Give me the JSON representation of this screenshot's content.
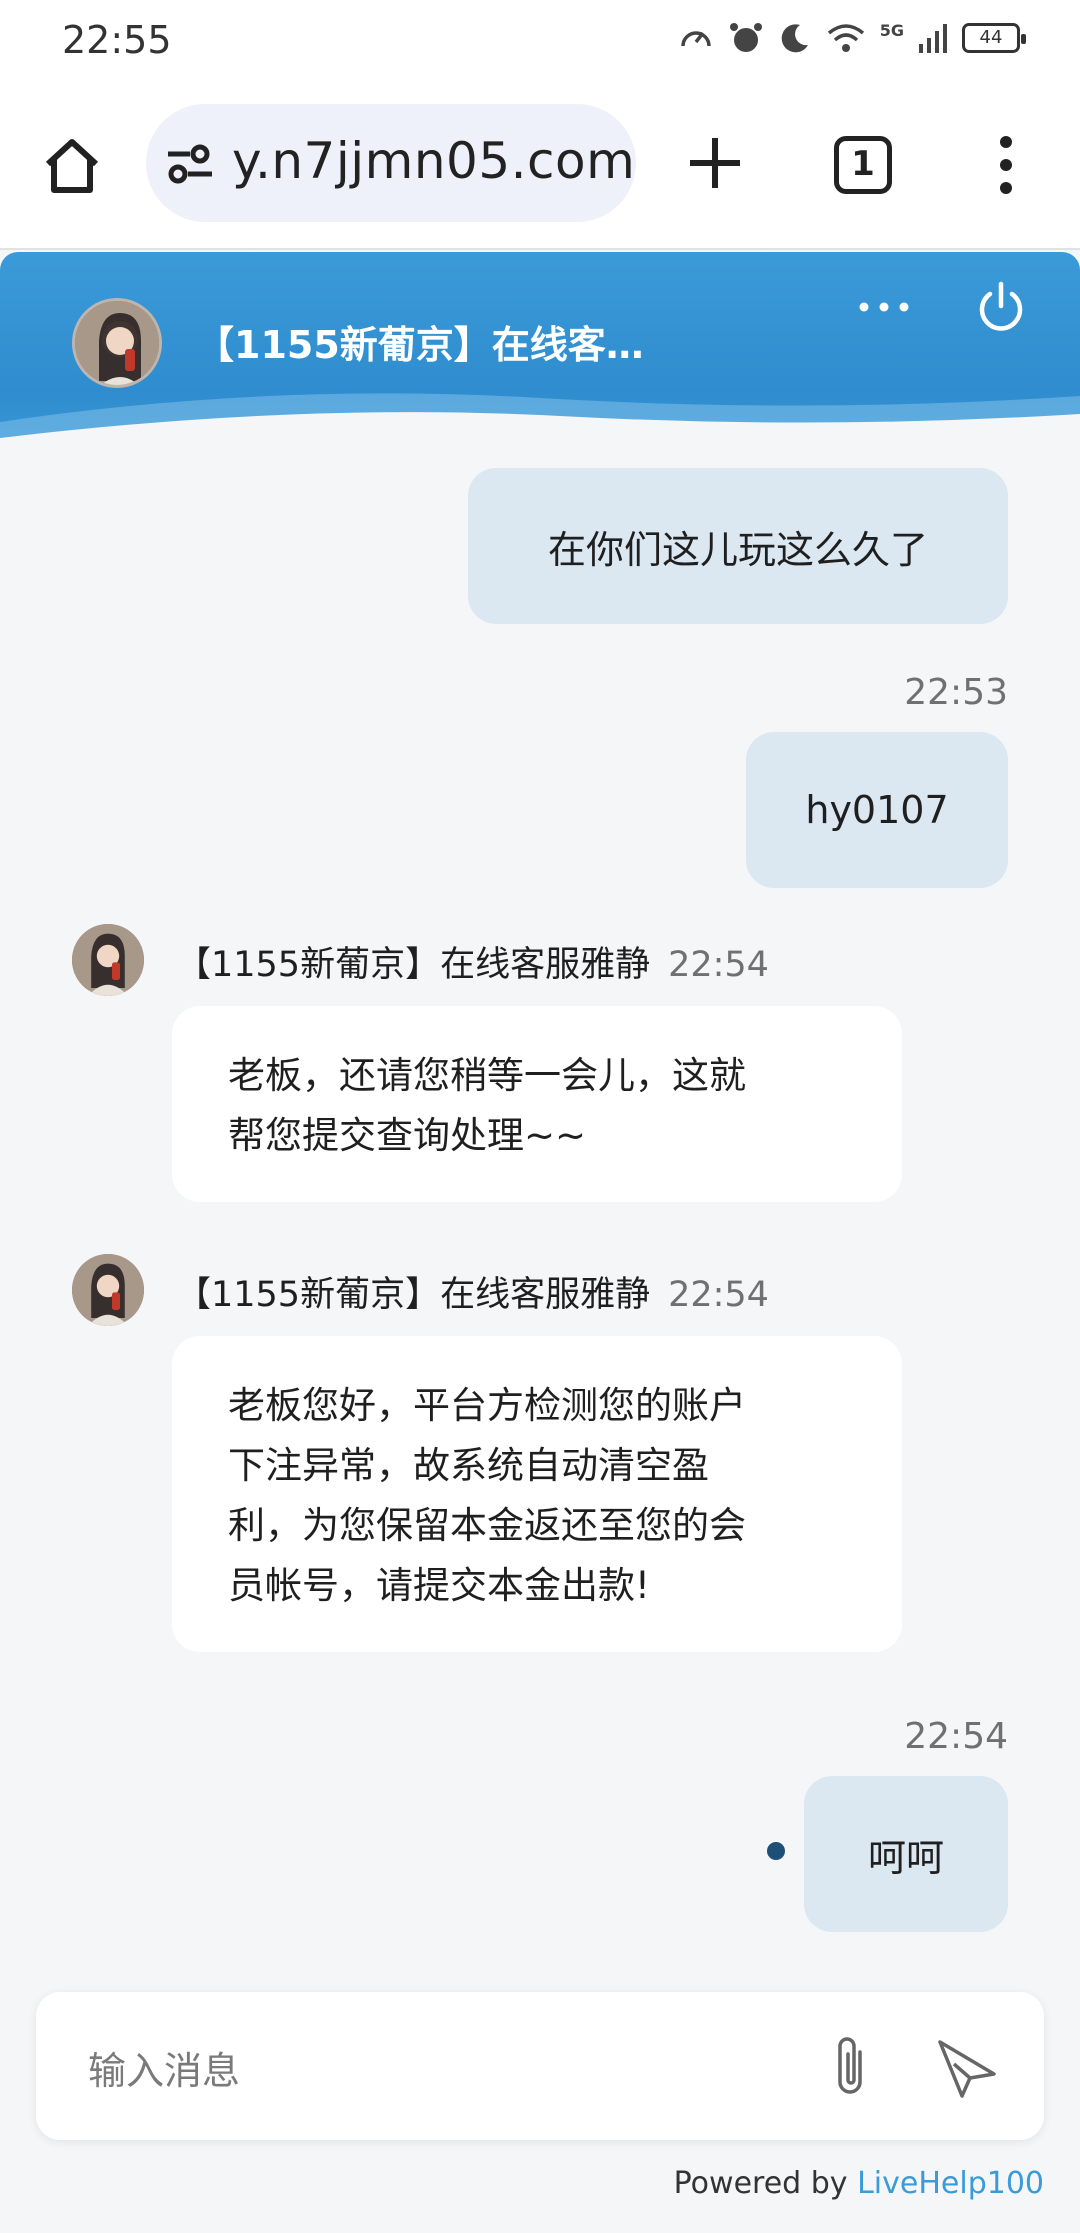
{
  "status_bar": {
    "time": "22:55",
    "battery": "44",
    "network": "5G"
  },
  "browser": {
    "url": "y.n7jjmn05.com",
    "tab_count": "1"
  },
  "chat_header": {
    "title": "【1155新葡京】在线客…"
  },
  "messages": [
    {
      "direction": "out",
      "text": "在你们这儿玩这么久了"
    },
    {
      "direction": "out",
      "time": "22:53",
      "text": "hy0107"
    },
    {
      "direction": "in",
      "sender": "【1155新葡京】在线客服雅静",
      "time": "22:54",
      "lines": [
        "老板，还请您稍等一会儿，这就",
        "帮您提交查询处理~~"
      ]
    },
    {
      "direction": "in",
      "sender": "【1155新葡京】在线客服雅静",
      "time": "22:54",
      "lines": [
        "老板您好，平台方检测您的账户",
        "下注异常，故系统自动清空盈",
        "利，为您保留本金返还至您的会",
        "员帐号，请提交本金出款!"
      ]
    },
    {
      "direction": "out",
      "time": "22:54",
      "text": "呵呵"
    }
  ],
  "input": {
    "placeholder": "输入消息"
  },
  "footer": {
    "powered_prefix": "Powered by ",
    "brand": "LiveHelp100"
  },
  "colors": {
    "header_blue": "#3b9ad8",
    "outgoing_bubble": "#dbe7f1",
    "incoming_bubble": "#ffffff",
    "unread_dot": "#1e4f77"
  },
  "icons": [
    "home-icon",
    "tune-icon",
    "plus-icon",
    "tabs-icon",
    "more-vert-icon",
    "more-horiz-icon",
    "power-icon",
    "paperclip-icon",
    "send-icon"
  ]
}
